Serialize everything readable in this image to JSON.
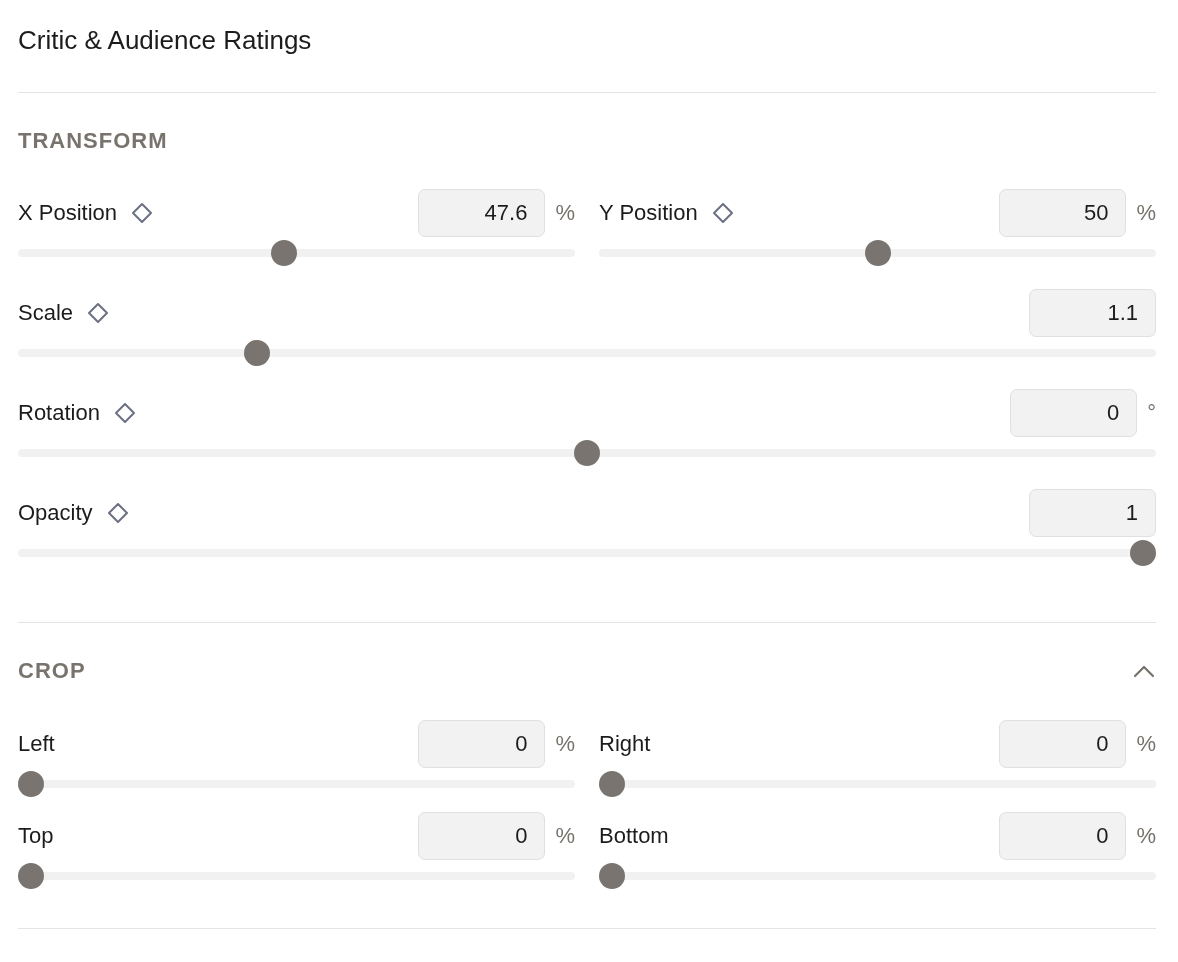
{
  "panel": {
    "title": "Critic & Audience Ratings"
  },
  "sections": [
    {
      "title": "TRANSFORM",
      "rows": [
        {
          "controls": [
            {
              "label": "X Position",
              "keyframe": true,
              "value": "47.6",
              "unit": "%",
              "level": 0.476
            },
            {
              "label": "Y Position",
              "keyframe": true,
              "value": "50",
              "unit": "%",
              "level": 0.5
            }
          ]
        },
        {
          "controls": [
            {
              "label": "Scale",
              "keyframe": true,
              "value": "1.1",
              "level": 0.203
            }
          ]
        },
        {
          "controls": [
            {
              "label": "Rotation",
              "keyframe": true,
              "value": "0",
              "unit": "°",
              "level": 0.5
            }
          ]
        },
        {
          "controls": [
            {
              "label": "Opacity",
              "keyframe": true,
              "value": "1",
              "level": 1
            }
          ]
        }
      ]
    },
    {
      "title": "CROP",
      "toggle": {
        "expanded": true
      },
      "rows": [
        {
          "controls": [
            {
              "label": "Left",
              "keyframe": false,
              "value": "0",
              "unit": "%",
              "level": 0
            },
            {
              "label": "Right",
              "keyframe": false,
              "value": "0",
              "unit": "%",
              "level": 0
            }
          ]
        },
        {
          "controls": [
            {
              "label": "Top",
              "keyframe": false,
              "value": "0",
              "unit": "%",
              "level": 0
            },
            {
              "label": "Bottom",
              "keyframe": false,
              "value": "0",
              "unit": "%",
              "level": 0
            }
          ]
        }
      ]
    }
  ]
}
